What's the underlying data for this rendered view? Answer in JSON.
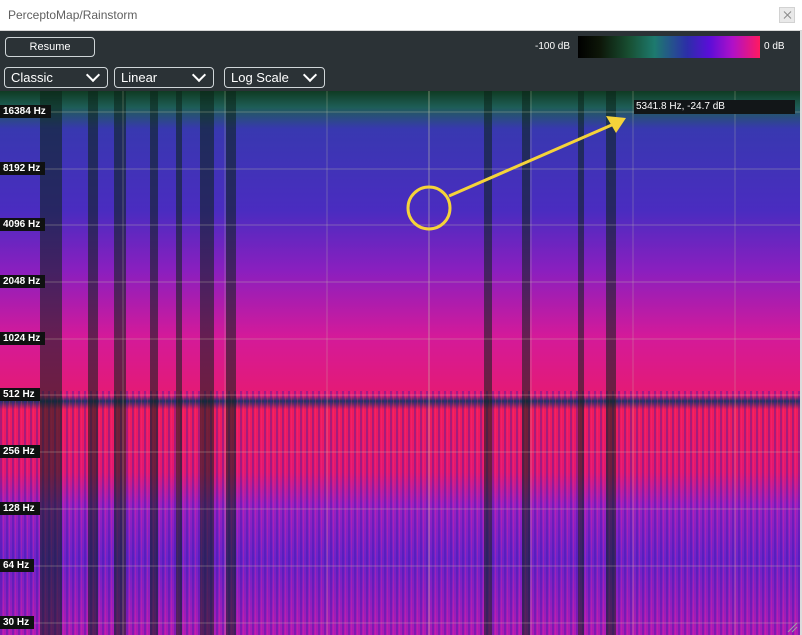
{
  "window": {
    "title": "PerceptoMap/Rainstorm"
  },
  "toolbar": {
    "resume_label": "Resume",
    "colormap_selected": "Classic",
    "amplitude_selected": "Linear",
    "freq_scale_selected": "Log Scale",
    "db_min_label": "-100 dB",
    "db_max_label": "0 dB"
  },
  "spectrogram": {
    "y_axis_labels": [
      "16384 Hz",
      "8192 Hz",
      "4096 Hz",
      "2048 Hz",
      "1024 Hz",
      "512 Hz",
      "256 Hz",
      "128 Hz",
      "64 Hz",
      "30 Hz"
    ],
    "cursor_readout": "5341.8 Hz, -24.7 dB",
    "colors": {
      "floor": "#0c1a10",
      "high": "#3b2fa3",
      "mid": "#c51a9c",
      "loud": "#ff1a52",
      "low": "#7a22c8",
      "annotation": "#f5d33a"
    }
  }
}
